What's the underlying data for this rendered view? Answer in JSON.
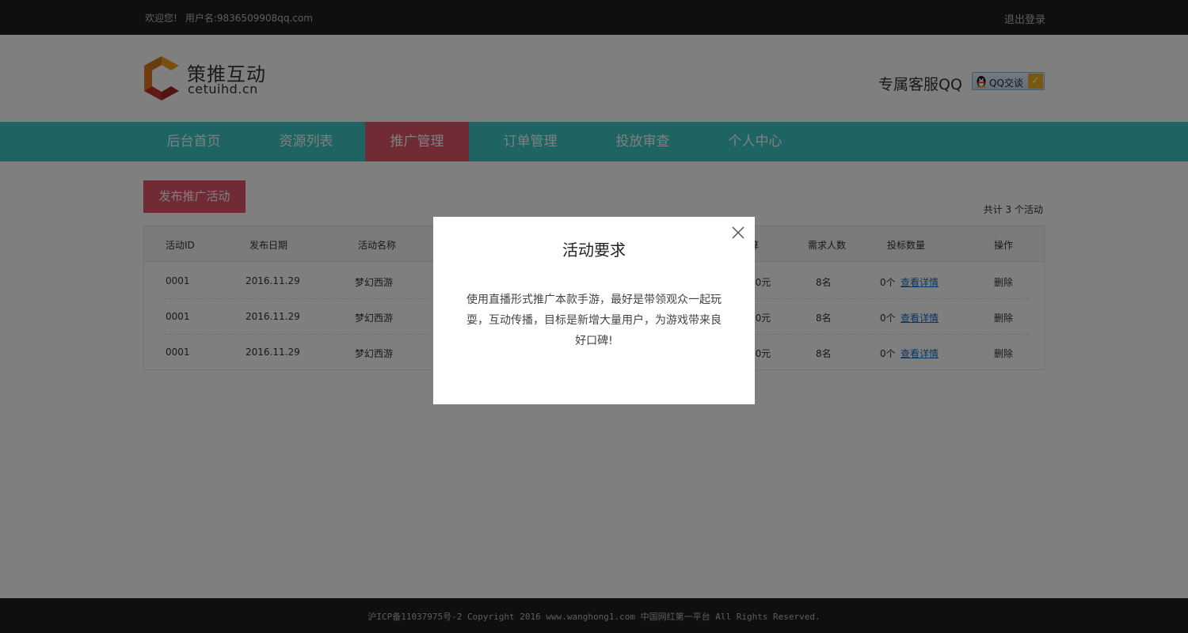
{
  "topbar": {
    "welcome": "欢迎您!",
    "username_label": "用户名:",
    "username": "9836509908qq.com",
    "logout": "退出登录"
  },
  "header": {
    "logo_cn": "策推互动",
    "logo_en": "cetuihd.cn",
    "service_label": "专属客服QQ",
    "qq_button": "QQ交谈"
  },
  "nav": {
    "items": [
      {
        "label": "后台首页",
        "active": false
      },
      {
        "label": "资源列表",
        "active": false
      },
      {
        "label": "推广管理",
        "active": true
      },
      {
        "label": "订单管理",
        "active": false
      },
      {
        "label": "投放审查",
        "active": false
      },
      {
        "label": "个人中心",
        "active": false
      }
    ]
  },
  "main": {
    "publish_button": "发布推广活动",
    "count_text": "共计 3 个活动",
    "table": {
      "headers": {
        "id": "活动ID",
        "date": "发布日期",
        "name": "活动名称",
        "budget_partial": "算",
        "demand": "需求人数",
        "bids": "投标数量",
        "action": "操作"
      },
      "rows": [
        {
          "id": "0001",
          "date": "2016.11.29",
          "name": "梦幻西游",
          "budget_partial": "00元",
          "demand": "8名",
          "bids": "0个",
          "detail": "查看详情",
          "delete": "删除"
        },
        {
          "id": "0001",
          "date": "2016.11.29",
          "name": "梦幻西游",
          "budget_partial": "00元",
          "demand": "8名",
          "bids": "0个",
          "detail": "查看详情",
          "delete": "删除"
        },
        {
          "id": "0001",
          "date": "2016.11.29",
          "name": "梦幻西游",
          "budget_partial": "00元",
          "demand": "8名",
          "bids": "0个",
          "detail": "查看详情",
          "delete": "删除"
        }
      ]
    }
  },
  "modal": {
    "title": "活动要求",
    "body": "使用直播形式推广本款手游，最好是带领观众一起玩耍，互动传播，目标是新增大量用户，为游戏带来良好口碑!"
  },
  "footer": {
    "text": "沪ICP备11037975号-2 Copyright 2016 www.wanghong1.com 中国网红第一平台 All Rights Reserved."
  },
  "colors": {
    "nav_bg": "#3cc8c7",
    "accent": "#e2576a",
    "dark_bar": "#1e1e1e",
    "link": "#1a6cc0"
  }
}
